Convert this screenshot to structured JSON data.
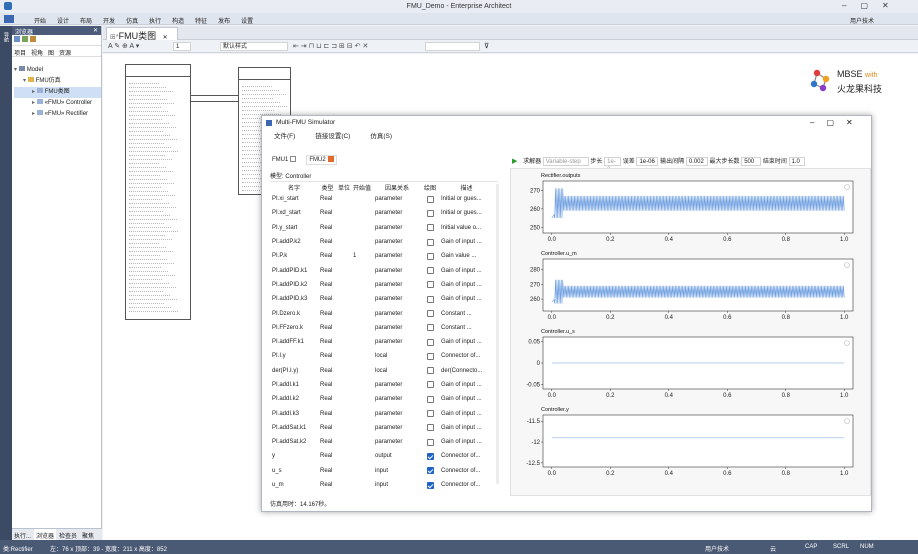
{
  "window": {
    "title": "FMU_Demo - Enterprise Architect"
  },
  "menu": {
    "items": [
      "开始",
      "设计",
      "布局",
      "开发",
      "仿真",
      "执行",
      "构造",
      "特征",
      "发布",
      "设置"
    ],
    "user": "用户技术"
  },
  "browser": {
    "title": "浏览器",
    "tabs": [
      "项目",
      "视角",
      "图",
      "资源"
    ],
    "tree": [
      {
        "label": "Model",
        "level": 0
      },
      {
        "label": "FMU仿真",
        "level": 1
      },
      {
        "label": "FMU类图",
        "level": 2
      },
      {
        "label": "«FMU» Controller",
        "level": 2
      },
      {
        "label": "«FMU» Rectifier",
        "level": 2
      }
    ],
    "bottom_tabs": [
      "执行...",
      "浏览器",
      "检查员",
      "聚焦"
    ]
  },
  "doc_tab": {
    "label": "FMU类图"
  },
  "toolbar": {
    "zoom": "1",
    "style": "默认样式"
  },
  "logo": {
    "line1": "MBSE",
    "with": "with",
    "line2": "火龙果科技"
  },
  "simulator": {
    "title": "Multi-FMU Simulator",
    "menu": [
      "文件(F)",
      "链接设置(C)",
      "仿真(S)"
    ],
    "fmu_tabs": [
      "FMU1",
      "FMU2"
    ],
    "model_label": "模型: Controller",
    "columns": [
      "名字",
      "类型",
      "单位",
      "开始值",
      "因果关系",
      "绘图",
      "描述"
    ],
    "rows": [
      {
        "name": "PI.xi_start",
        "type": "Real",
        "start": "",
        "causality": "parameter",
        "plot": false,
        "desc": "Initial or gues..."
      },
      {
        "name": "PI.xd_start",
        "type": "Real",
        "start": "",
        "causality": "parameter",
        "plot": false,
        "desc": "Initial or gues..."
      },
      {
        "name": "PI.y_start",
        "type": "Real",
        "start": "",
        "causality": "parameter",
        "plot": false,
        "desc": "Initial value o..."
      },
      {
        "name": "PI.addP.k2",
        "type": "Real",
        "start": "",
        "causality": "parameter",
        "plot": false,
        "desc": "Gain of input ..."
      },
      {
        "name": "PI.P.k",
        "type": "Real",
        "start": "1",
        "causality": "parameter",
        "plot": false,
        "desc": "Gain value ..."
      },
      {
        "name": "PI.addPID.k1",
        "type": "Real",
        "start": "",
        "causality": "parameter",
        "plot": false,
        "desc": "Gain of input ..."
      },
      {
        "name": "PI.addPID.k2",
        "type": "Real",
        "start": "",
        "causality": "parameter",
        "plot": false,
        "desc": "Gain of input ..."
      },
      {
        "name": "PI.addPID.k3",
        "type": "Real",
        "start": "",
        "causality": "parameter",
        "plot": false,
        "desc": "Gain of input ..."
      },
      {
        "name": "PI.Dzero.k",
        "type": "Real",
        "start": "",
        "causality": "parameter",
        "plot": false,
        "desc": "Constant ..."
      },
      {
        "name": "PI.FFzero.k",
        "type": "Real",
        "start": "",
        "causality": "parameter",
        "plot": false,
        "desc": "Constant ..."
      },
      {
        "name": "PI.addFF.k1",
        "type": "Real",
        "start": "",
        "causality": "parameter",
        "plot": false,
        "desc": "Gain of input ..."
      },
      {
        "name": "PI.I.y",
        "type": "Real",
        "start": "",
        "causality": "local",
        "plot": false,
        "desc": "Connector of..."
      },
      {
        "name": "der(PI.I.y)",
        "type": "Real",
        "start": "",
        "causality": "local",
        "plot": false,
        "desc": "der(Connecto..."
      },
      {
        "name": "PI.addI.k1",
        "type": "Real",
        "start": "",
        "causality": "parameter",
        "plot": false,
        "desc": "Gain of input ..."
      },
      {
        "name": "PI.addI.k2",
        "type": "Real",
        "start": "",
        "causality": "parameter",
        "plot": false,
        "desc": "Gain of input ..."
      },
      {
        "name": "PI.addI.k3",
        "type": "Real",
        "start": "",
        "causality": "parameter",
        "plot": false,
        "desc": "Gain of input ..."
      },
      {
        "name": "PI.addSat.k1",
        "type": "Real",
        "start": "",
        "causality": "parameter",
        "plot": false,
        "desc": "Gain of input ..."
      },
      {
        "name": "PI.addSat.k2",
        "type": "Real",
        "start": "",
        "causality": "parameter",
        "plot": false,
        "desc": "Gain of input ..."
      },
      {
        "name": "y",
        "type": "Real",
        "start": "",
        "causality": "output",
        "plot": true,
        "desc": "Connector of..."
      },
      {
        "name": "u_s",
        "type": "Real",
        "start": "",
        "causality": "input",
        "plot": true,
        "desc": "Connector of..."
      },
      {
        "name": "u_m",
        "type": "Real",
        "start": "",
        "causality": "input",
        "plot": true,
        "desc": "Connector of..."
      }
    ],
    "footer": "仿真用时：14.167秒。",
    "controls": {
      "solver_label": "求解器",
      "solver": "Variable-step",
      "step_label": "步长",
      "step": "1e-3",
      "tol_label": "误差",
      "tol": "1e-06",
      "interval_label": "输出间隔",
      "interval": "0.002",
      "maxsteps_label": "最大步长数",
      "maxsteps": "500",
      "end_label": "结束时间",
      "end": "1.0"
    }
  },
  "chart_data": [
    {
      "type": "line",
      "title": "Rectifier.outputs",
      "x": [
        0.0,
        0.2,
        0.4,
        0.6,
        0.8,
        1.0
      ],
      "yticks": [
        250,
        260,
        270
      ],
      "ylim": [
        247,
        275
      ],
      "xlim": [
        -0.03,
        1.03
      ],
      "series": [
        {
          "y_start": 255,
          "y_settle": 263,
          "ripple": 4
        }
      ]
    },
    {
      "type": "line",
      "title": "Controller.u_m",
      "x": [
        0.0,
        0.2,
        0.4,
        0.6,
        0.8,
        1.0
      ],
      "yticks": [
        260,
        270,
        280
      ],
      "ylim": [
        252,
        287
      ],
      "xlim": [
        -0.03,
        1.03
      ],
      "series": [
        {
          "y_start": 258,
          "y_settle": 265,
          "ripple": 4
        }
      ]
    },
    {
      "type": "line",
      "title": "Controller.u_s",
      "x": [
        0.0,
        0.2,
        0.4,
        0.6,
        0.8,
        1.0
      ],
      "yticks": [
        -0.05,
        0.0,
        0.05
      ],
      "ylim": [
        -0.06,
        0.06
      ],
      "xlim": [
        -0.03,
        1.03
      ],
      "series": [
        {
          "y_start": 0,
          "y_settle": 0,
          "ripple": 0
        }
      ]
    },
    {
      "type": "line",
      "title": "Controller.y",
      "x": [
        0.0,
        0.2,
        0.4,
        0.6,
        0.8,
        1.0
      ],
      "yticks": [
        -12.5,
        -12.0,
        -11.5
      ],
      "ylim": [
        -12.6,
        -11.35
      ],
      "xlim": [
        -0.03,
        1.03
      ],
      "series": [
        {
          "y_start": -11.9,
          "y_settle": -11.9,
          "ripple": 0
        }
      ]
    }
  ],
  "status": {
    "left": "类:Rectifier",
    "coords": "左：76 x 顶部：39 - 宽度：211 x 高度：852",
    "user": "用户技术",
    "caps": "CAP",
    "num": "NUM",
    "scrl": "SCRL",
    "cloud": "云"
  }
}
